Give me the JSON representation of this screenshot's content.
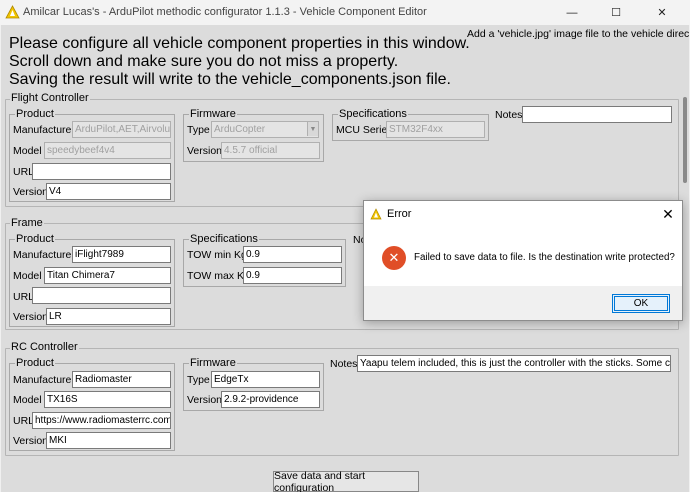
{
  "window": {
    "title": "Amilcar Lucas's - ArduPilot methodic configurator 1.1.3 - Vehicle Component Editor",
    "minimize_glyph": "—",
    "maximize_glyph": "☐",
    "close_glyph": "✕"
  },
  "intro": {
    "line1": "Please configure all vehicle component properties in this window.",
    "line2": "Scroll down and make sure you do not miss a property.",
    "line3": "Saving the result will write to the vehicle_components.json file."
  },
  "hint": "Add a 'vehicle.jpg' image file to the vehicle directory.",
  "flight_controller": {
    "title": "Flight Controller",
    "product": {
      "title": "Product",
      "manufacturer_label": "Manufacturer",
      "manufacturer_value": "ArduPilot,AET,Airvolut",
      "model_label": "Model",
      "model_value": "speedybeef4v4",
      "url_label": "URL",
      "url_value": "",
      "version_label": "Version",
      "version_value": "V4"
    },
    "firmware": {
      "title": "Firmware",
      "type_label": "Type",
      "type_value": "ArduCopter",
      "version_label": "Version",
      "version_value": "4.5.7 official"
    },
    "specifications": {
      "title": "Specifications",
      "mcu_label": "MCU Series",
      "mcu_value": "STM32F4xx"
    },
    "notes_label": "Notes",
    "notes_value": ""
  },
  "frame": {
    "title": "Frame",
    "product": {
      "title": "Product",
      "manufacturer_label": "Manufacturer",
      "manufacturer_value": "iFlight7989",
      "model_label": "Model",
      "model_value": "Titan Chimera7",
      "url_label": "URL",
      "url_value": "",
      "version_label": "Version",
      "version_value": "LR"
    },
    "specifications": {
      "title": "Specifications",
      "tow_min_label": "TOW min Kg",
      "tow_min_value": "0.9",
      "tow_max_label": "TOW max Kg",
      "tow_max_value": "0.9"
    },
    "notes_label": "No"
  },
  "rc_controller": {
    "title": "RC Controller",
    "product": {
      "title": "Product",
      "manufacturer_label": "Manufacturer",
      "manufacturer_value": "Radiomaster",
      "model_label": "Model",
      "model_value": "TX16S",
      "url_label": "URL",
      "url_value": "https://www.radiomasterrc.com",
      "version_label": "Version",
      "version_value": "MKI"
    },
    "firmware": {
      "title": "Firmware",
      "type_label": "Type",
      "type_value": "EdgeTx",
      "version_label": "Version",
      "version_value": "2.9.2-providence"
    },
    "notes_label": "Notes",
    "notes_value": "Yaapu telem included, this is just the controller with the sticks. Some contro"
  },
  "save_button": "Save data and start configuration",
  "dialog": {
    "title": "Error",
    "message": "Failed to save data to file. Is the destination write protected?",
    "ok_label": "OK",
    "error_glyph": "✕",
    "close_glyph": "✕"
  },
  "colors": {
    "client_bg": "#dcdcdc",
    "error_red": "#e04e27",
    "ok_border": "#0078d7"
  }
}
